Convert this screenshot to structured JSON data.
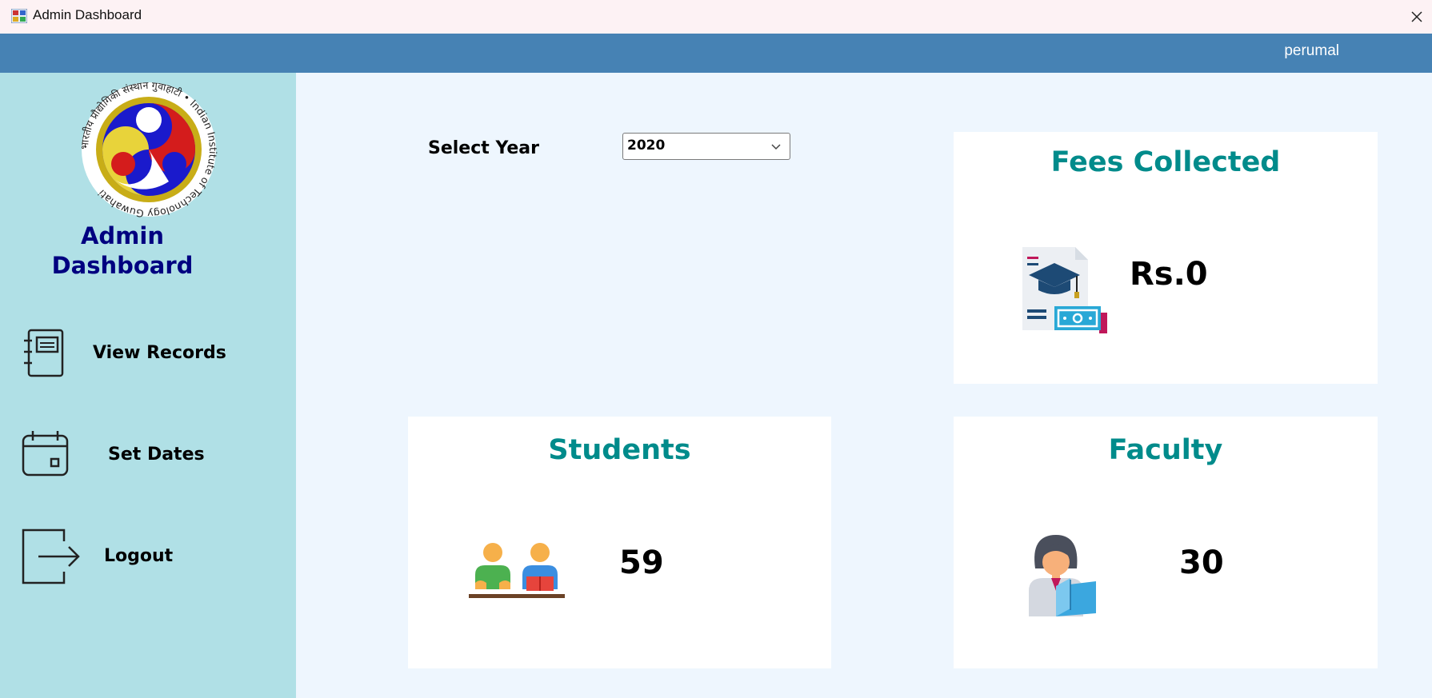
{
  "window": {
    "title": "Admin Dashboard",
    "app_icon": "app-icon",
    "close_icon": "close-icon"
  },
  "header": {
    "username": "perumal",
    "bar_color": "#4682b4"
  },
  "sidebar": {
    "logo_icon": "iit-guwahati-logo",
    "logo_text": "भारतीय प्रौद्योगिकी संस्थान गुवाहाटी • Indian Institute of Technology Guwahati",
    "title_line1": "Admin",
    "title_line2": "Dashboard",
    "items": [
      {
        "label": "View Records",
        "icon": "records-book-icon"
      },
      {
        "label": "Set Dates",
        "icon": "calendar-icon"
      },
      {
        "label": "Logout",
        "icon": "logout-icon"
      }
    ],
    "background": "#b0e0e6"
  },
  "main": {
    "year_label": "Select Year",
    "year_select": {
      "value": "2020"
    },
    "cards": {
      "fees": {
        "title": "Fees Collected",
        "value": "Rs.0",
        "icon": "fee-certificate-icon"
      },
      "students": {
        "title": "Students",
        "value": "59",
        "icon": "students-icon"
      },
      "faculty": {
        "title": "Faculty",
        "value": "30",
        "icon": "teacher-icon"
      }
    },
    "accent": "#008b8b"
  }
}
